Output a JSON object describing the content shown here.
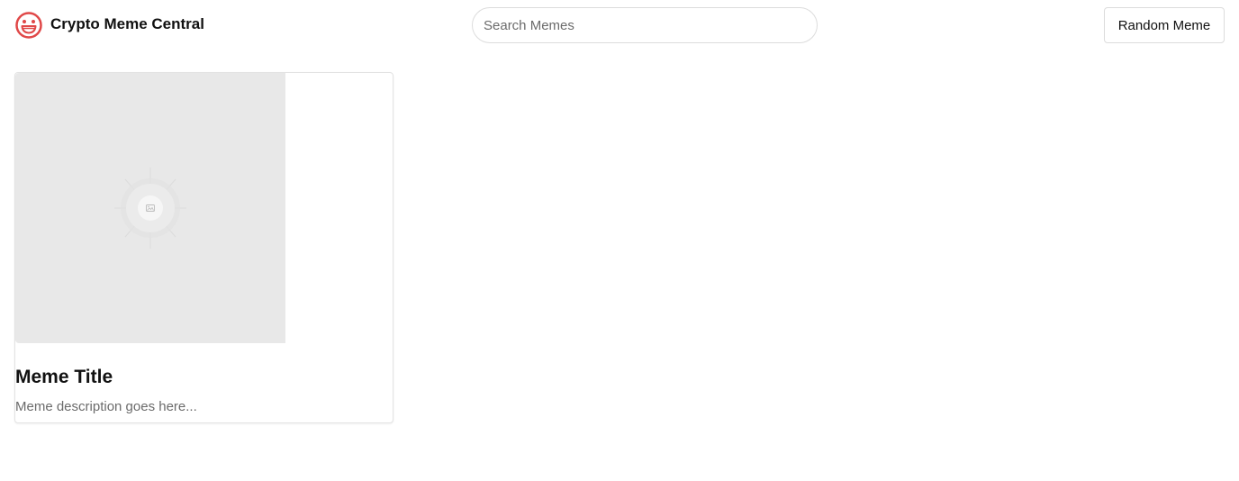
{
  "header": {
    "logo_icon": "smiley-face-icon",
    "title": "Crypto Meme Central",
    "search_placeholder": "Search Memes",
    "random_button_label": "Random Meme"
  },
  "cards": [
    {
      "image_icon": "image-placeholder-icon",
      "title": "Meme Title",
      "description": "Meme description goes here..."
    }
  ],
  "colors": {
    "logo": "#e04848",
    "image_placeholder_bg": "#e8e8e8",
    "muted_text": "#6b6b6b"
  }
}
